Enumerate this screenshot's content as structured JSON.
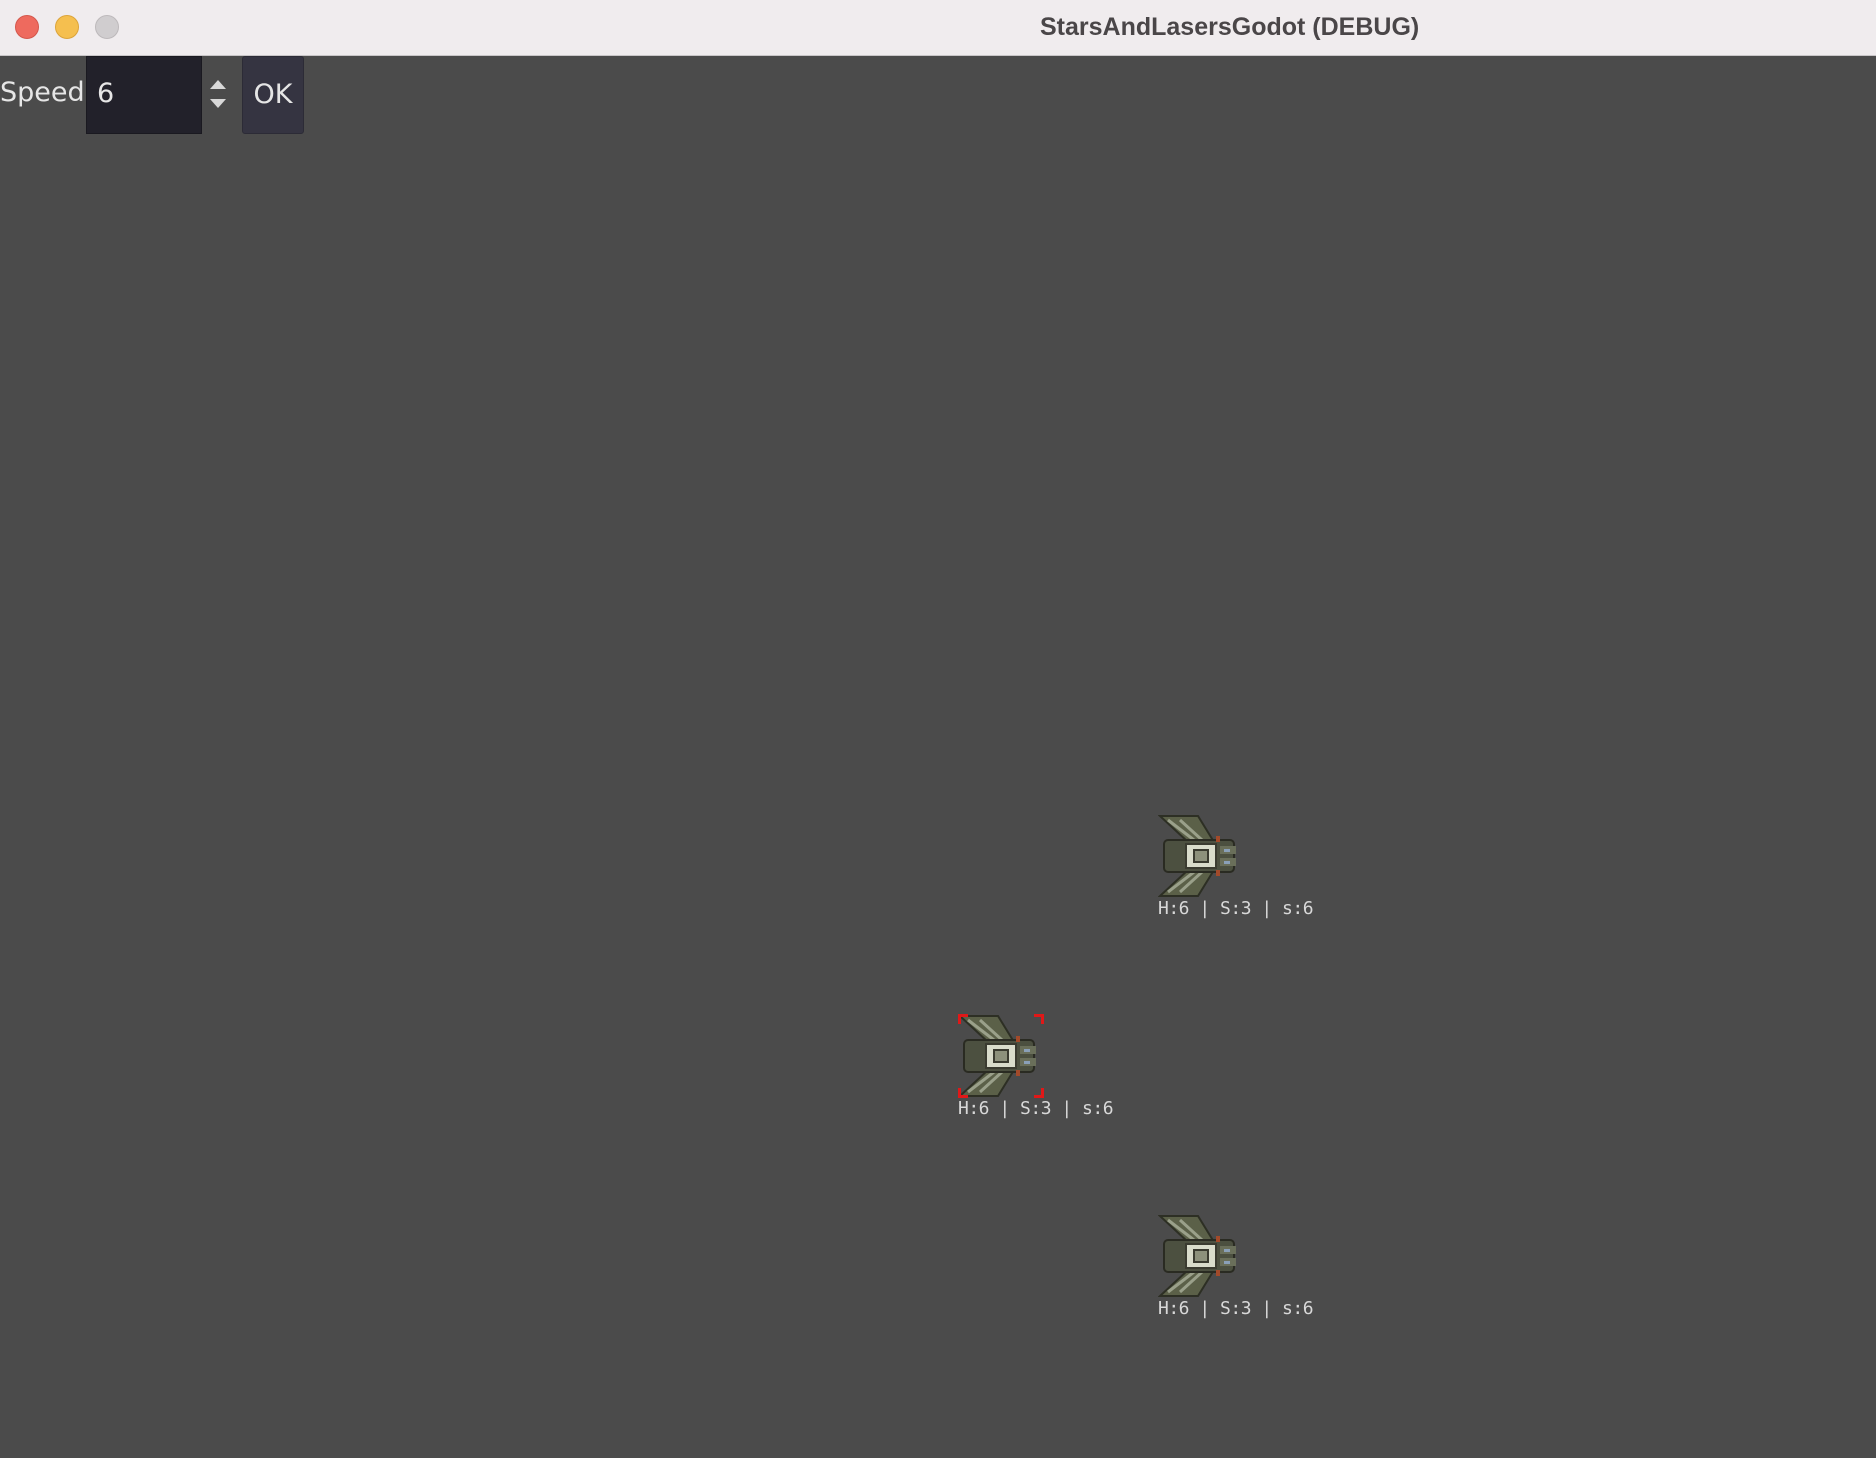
{
  "window": {
    "title": "StarsAndLasersGodot (DEBUG)"
  },
  "toolbar": {
    "speed_label": "Speed",
    "speed_value": "6",
    "ok_label": "OK"
  },
  "ships": [
    {
      "label": "H:6 | S:3 | s:6",
      "selected": false
    },
    {
      "label": "H:6 | S:3 | s:6",
      "selected": true
    },
    {
      "label": "H:6 | S:3 | s:6",
      "selected": false
    }
  ],
  "colors": {
    "viewport": "#4b4b4b",
    "selection": "#e01818",
    "spinbox": "#22212a",
    "button": "#353441"
  }
}
